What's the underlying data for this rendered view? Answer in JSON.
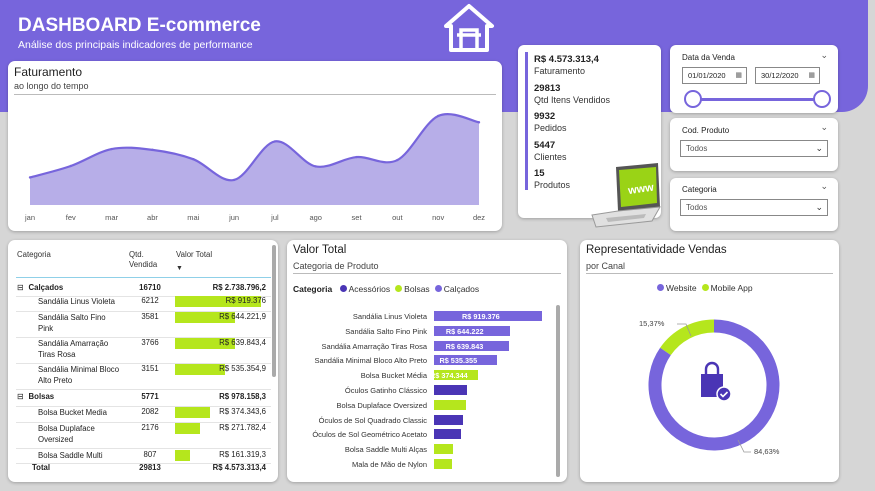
{
  "header": {
    "title": "DASHBOARD E-commerce",
    "subtitle": "Análise dos principais indicadores de performance",
    "icon": "home-icon",
    "accent": "#7765dc"
  },
  "faturamento": {
    "title": "Faturamento",
    "subtitle": "ao longo do tempo"
  },
  "chart_data": [
    {
      "type": "area",
      "title": "Faturamento",
      "subtitle": "ao longo do tempo",
      "x": [
        "jan",
        "fev",
        "mar",
        "abr",
        "mai",
        "jun",
        "jul",
        "ago",
        "set",
        "out",
        "nov",
        "dez"
      ],
      "values": [
        0.15,
        0.42,
        0.82,
        0.8,
        0.58,
        0.09,
        1.0,
        0.41,
        0.63,
        0.56,
        1.6,
        1.45
      ],
      "ylim": [
        -0.5,
        2.0
      ],
      "color": "#7765dc",
      "fill": "#b7aee8"
    },
    {
      "type": "bar",
      "title": "Valor Total",
      "subtitle": "Categoria de Produto",
      "legend_title": "Categoria",
      "legend": [
        {
          "name": "Acessórios",
          "color": "#4a35b5"
        },
        {
          "name": "Bolsas",
          "color": "#b5e61d"
        },
        {
          "name": "Calçados",
          "color": "#7765dc"
        }
      ],
      "categories": [
        "Sandália Linus Violeta",
        "Sandália Salto Fino Pink",
        "Sandália Amarração Tiras Rosa",
        "Sandália Minimal Bloco Alto Preto",
        "Bolsa Bucket Média",
        "Óculos Gatinho Clássico",
        "Bolsa Duplaface Oversized",
        "Óculos de Sol Quadrado Classic",
        "Óculos de Sol Geométrico Acetato",
        "Bolsa Saddle Multi Alças",
        "Mala de Mão de Nylon"
      ],
      "values": [
        919376,
        644222,
        639843,
        535355,
        374343,
        280000,
        271782,
        250000,
        230000,
        161319,
        150000
      ],
      "groups": [
        "Calçados",
        "Calçados",
        "Calçados",
        "Calçados",
        "Bolsas",
        "Acessórios",
        "Bolsas",
        "Acessórios",
        "Acessórios",
        "Bolsas",
        "Bolsas"
      ],
      "labels": [
        "R$ 919.376",
        "R$ 644.222",
        "R$ 639.843",
        "R$ 535.355",
        "R$ 374.344",
        "",
        "",
        "",
        "",
        "",
        ""
      ]
    },
    {
      "type": "pie",
      "title": "Representatividade Vendas",
      "subtitle": "por Canal",
      "categories": [
        "Website",
        "Mobile App"
      ],
      "values": [
        84.63,
        15.37
      ],
      "labels": [
        "84,63%",
        "15,37%"
      ],
      "colors": [
        "#7765dc",
        "#b5e61d"
      ]
    }
  ],
  "kpis": [
    {
      "value": "R$ 4.573.313,4",
      "label": "Faturamento"
    },
    {
      "value": "29813",
      "label": "Qtd Itens Vendidos"
    },
    {
      "value": "9932",
      "label": "Pedidos"
    },
    {
      "value": "5447",
      "label": "Clientes"
    },
    {
      "value": "15",
      "label": "Produtos"
    }
  ],
  "filters": {
    "date": {
      "title": "Data da Venda",
      "start": "01/01/2020",
      "end": "30/12/2020"
    },
    "produto": {
      "title": "Cod. Produto",
      "value": "Todos"
    },
    "categoria": {
      "title": "Categoria",
      "value": "Todos"
    }
  },
  "table": {
    "headers": {
      "categoria": "Categoria",
      "qtd": "Qtd. Vendida",
      "valor": "Valor Total"
    },
    "rows": [
      {
        "type": "group",
        "cat": "Calçados",
        "qtd": "16710",
        "val": "R$ 2.738.796,2"
      },
      {
        "type": "item",
        "cat": "Sandália Linus Violeta",
        "qtd": "6212",
        "val": "R$ 919.376",
        "bar": 919376
      },
      {
        "type": "item",
        "cat": "Sandália Salto Fino Pink",
        "qtd": "3581",
        "val": "R$ 644.221,9",
        "bar": 644222
      },
      {
        "type": "item",
        "cat": "Sandália Amarração Tiras Rosa",
        "qtd": "3766",
        "val": "R$ 639.843,4",
        "bar": 639843
      },
      {
        "type": "item",
        "cat": "Sandália Minimal Bloco Alto Preto",
        "qtd": "3151",
        "val": "R$ 535.354,9",
        "bar": 535355
      },
      {
        "type": "group",
        "cat": "Bolsas",
        "qtd": "5771",
        "val": "R$ 978.158,3"
      },
      {
        "type": "item",
        "cat": "Bolsa Bucket Media",
        "qtd": "2082",
        "val": "R$ 374.343,6",
        "bar": 374344
      },
      {
        "type": "item",
        "cat": "Bolsa Duplaface Oversized",
        "qtd": "2176",
        "val": "R$ 271.782,4",
        "bar": 271782
      },
      {
        "type": "item",
        "cat": "Bolsa Saddle Multi",
        "qtd": "807",
        "val": "R$ 161.319,3",
        "bar": 161319
      }
    ],
    "total": {
      "label": "Total",
      "qtd": "29813",
      "val": "R$ 4.573.313,4"
    }
  }
}
